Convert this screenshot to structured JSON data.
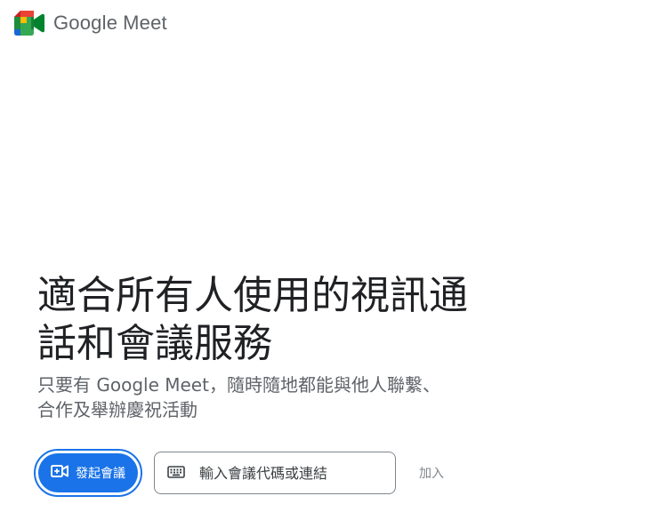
{
  "header": {
    "logo_icon": "google-meet-logo-icon",
    "brand_google": "Google",
    "brand_product": "Meet"
  },
  "hero": {
    "headline": "適合所有人使用的視訊通話和會議服務",
    "subline": "只要有 Google Meet，隨時隨地都能與他人聯繫、合作及舉辦慶祝活動"
  },
  "actions": {
    "new_meeting_icon": "video-plus-icon",
    "new_meeting_label": "發起會議",
    "code_input_icon": "keyboard-icon",
    "code_input_placeholder": "輸入會議代碼或連結",
    "code_input_value": "",
    "join_label": "加入"
  },
  "colors": {
    "accent": "#1a73e8",
    "text_primary": "#202124",
    "text_secondary": "#5f6368",
    "disabled": "#80868b"
  }
}
